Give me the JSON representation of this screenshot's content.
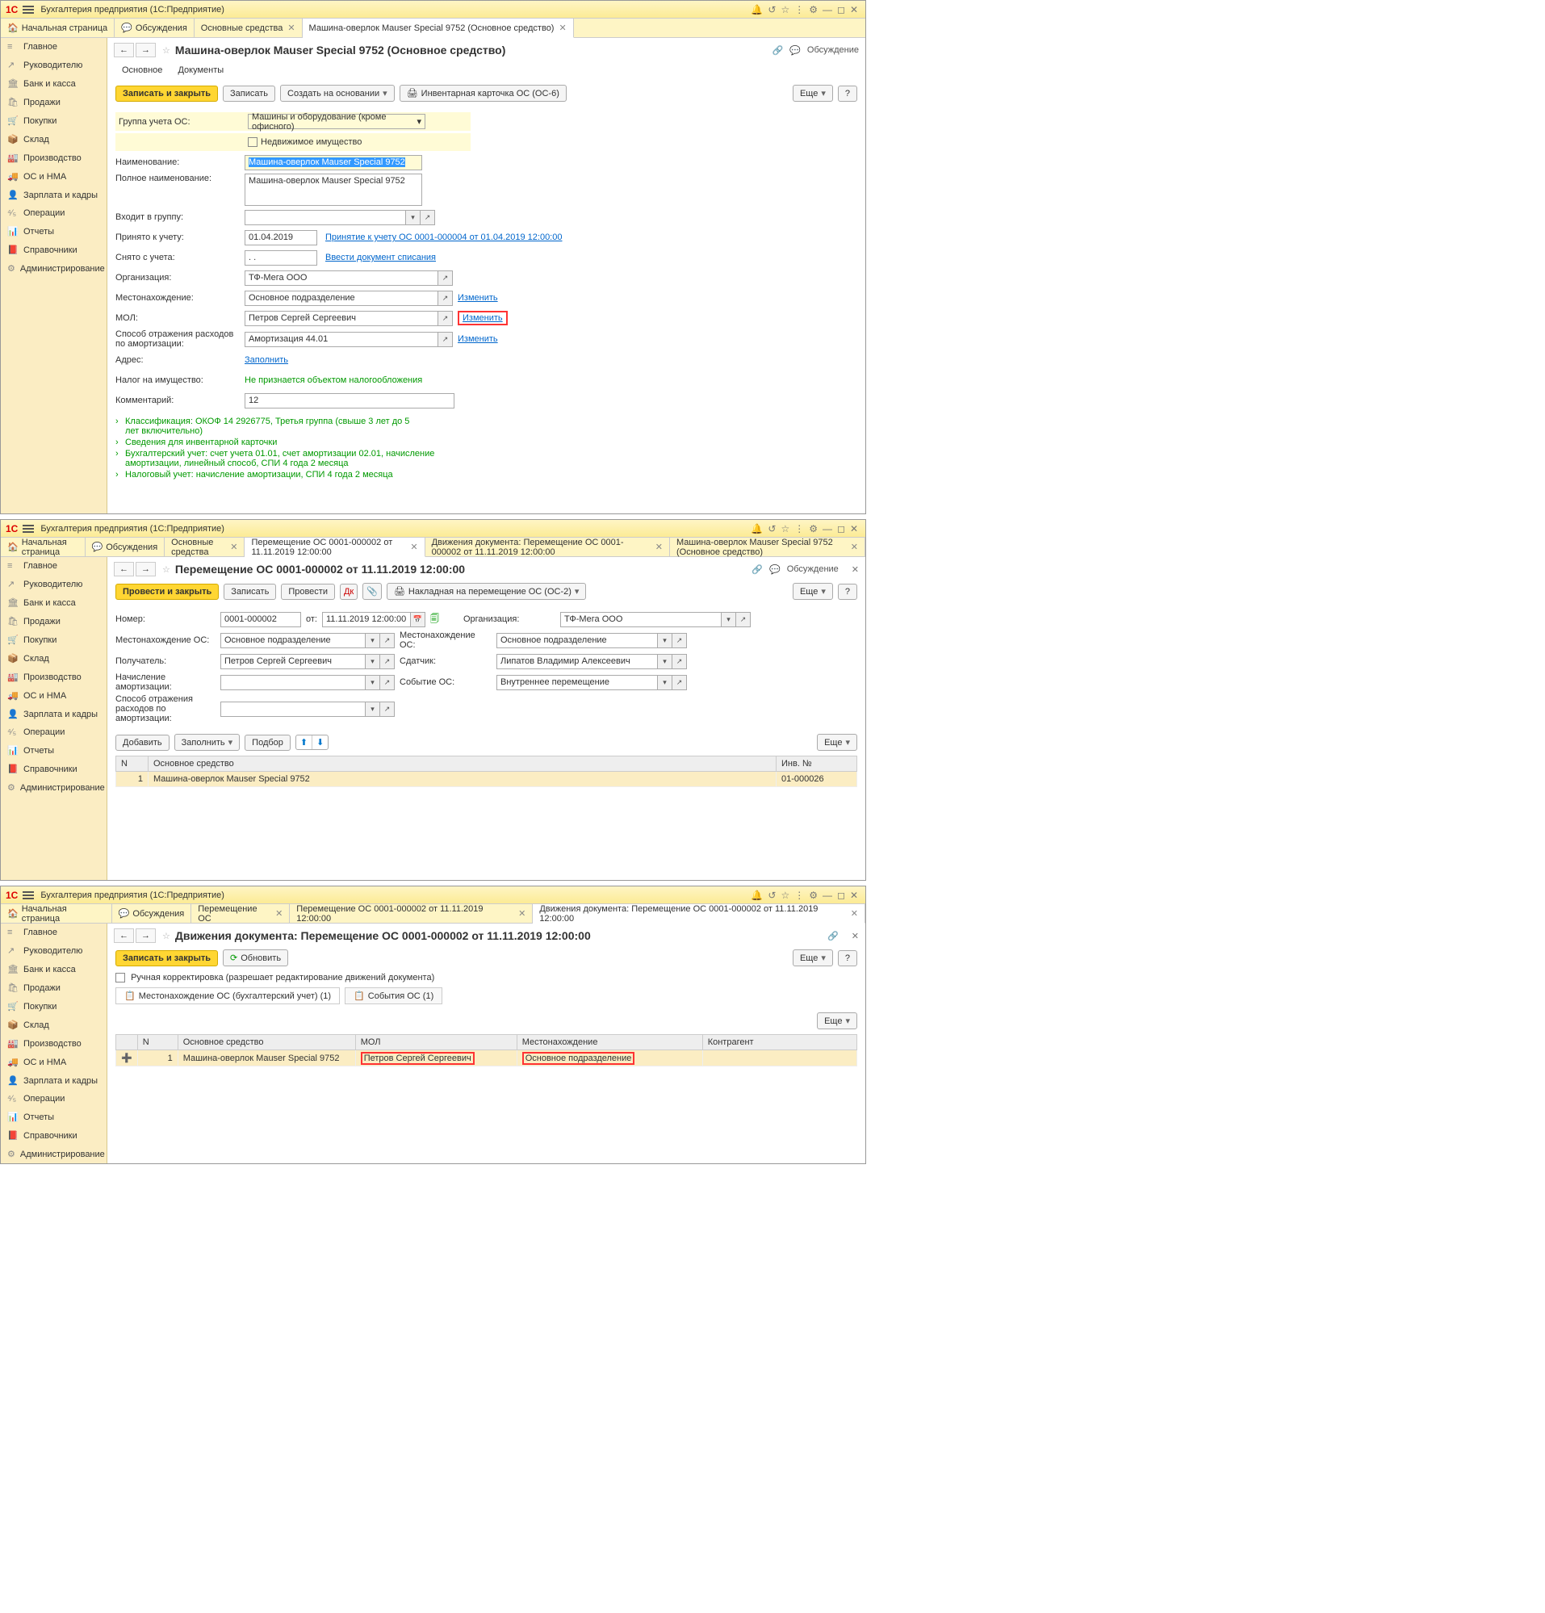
{
  "app_title": "Бухгалтерия предприятия  (1С:Предприятие)",
  "home_tab": "Начальная страница",
  "discuss_tab": "Обсуждения",
  "discuss_link": "Обсуждение",
  "sidebar": [
    {
      "icon": "≡",
      "label": "Главное"
    },
    {
      "icon": "↗",
      "label": "Руководителю"
    },
    {
      "icon": "🏛",
      "label": "Банк и касса"
    },
    {
      "icon": "🛍",
      "label": "Продажи"
    },
    {
      "icon": "🛒",
      "label": "Покупки"
    },
    {
      "icon": "📦",
      "label": "Склад"
    },
    {
      "icon": "🏭",
      "label": "Производство"
    },
    {
      "icon": "🚚",
      "label": "ОС и НМА"
    },
    {
      "icon": "👤",
      "label": "Зарплата и кадры"
    },
    {
      "icon": "⁴⁄₅",
      "label": "Операции"
    },
    {
      "icon": "📊",
      "label": "Отчеты"
    },
    {
      "icon": "📕",
      "label": "Справочники"
    },
    {
      "icon": "⚙",
      "label": "Администрирование"
    }
  ],
  "more_btn": "Еще",
  "help_btn": "?",
  "w1": {
    "tabs": [
      "Основные средства",
      "Машина-оверлок Mauser Special 9752 (Основное средство)"
    ],
    "title": "Машина-оверлок Mauser Special 9752 (Основное средство)",
    "subtabs": {
      "main": "Основное",
      "docs": "Документы"
    },
    "buttons": {
      "save_close": "Записать и закрыть",
      "save": "Записать",
      "create": "Создать на основании",
      "print": "Инвентарная карточка ОС (ОС-6)"
    },
    "labels": {
      "group": "Группа учета ОС:",
      "real_estate": "Недвижимое имущество",
      "name": "Наименование:",
      "full_name": "Полное наименование:",
      "in_group": "Входит в группу:",
      "accepted": "Принято к учету:",
      "removed": "Снято с учета:",
      "org": "Организация:",
      "location": "Местонахождение:",
      "mol": "МОЛ:",
      "method": "Способ отражения расходов по амортизации:",
      "address": "Адрес:",
      "tax": "Налог на имущество:",
      "comment": "Комментарий:"
    },
    "values": {
      "group": "Машины и оборудование (кроме офисного)",
      "name": "Машина-оверлок Mauser Special 9752",
      "full_name": "Машина-оверлок Mauser Special 9752",
      "accepted_date": "01.04.2019",
      "removed_date": ". .",
      "org": "ТФ-Мега ООО",
      "location": "Основное подразделение",
      "mol": "Петров Сергей Сергеевич",
      "method": "Амортизация 44.01",
      "tax": "Не признается объектом налогообложения",
      "comment": "12"
    },
    "links": {
      "accept": "Принятие к учету ОС 0001-000004 от 01.04.2019 12:00:00",
      "remove": "Ввести документ списания",
      "change": "Изменить",
      "fill": "Заполнить"
    },
    "expands": [
      "Классификация: ОКОФ 14 2926775, Третья группа (свыше 3 лет до 5 лет включительно)",
      "Сведения для инвентарной карточки",
      "Бухгалтерский учет: счет учета 01.01, счет амортизации 02.01, начисление амортизации, линейный способ, СПИ 4 года 2 месяца",
      "Налоговый учет: начисление амортизации, СПИ 4 года 2 месяца"
    ]
  },
  "w2": {
    "tabs": [
      "Основные средства",
      "Перемещение ОС 0001-000002 от 11.11.2019 12:00:00",
      "Движения документа: Перемещение ОС 0001-000002 от 11.11.2019 12:00:00",
      "Машина-оверлок Mauser Special 9752 (Основное средство)"
    ],
    "title": "Перемещение ОС 0001-000002 от 11.11.2019 12:00:00",
    "buttons": {
      "post_close": "Провести и закрыть",
      "save": "Записать",
      "post": "Провести",
      "print": "Накладная на перемещение ОС (ОС-2)",
      "add": "Добавить",
      "fill": "Заполнить",
      "pick": "Подбор"
    },
    "labels": {
      "number": "Номер:",
      "date": "от:",
      "org": "Организация:",
      "loc_os": "Местонахождение ОС:",
      "recv": "Получатель:",
      "amort": "Начисление амортизации:",
      "method": "Способ отражения расходов по амортизации:",
      "sender": "Сдатчик:",
      "event": "Событие ОС:"
    },
    "values": {
      "number": "0001-000002",
      "date": "11.11.2019 12:00:00",
      "org": "ТФ-Мега ООО",
      "loc_os1": "Основное подразделение",
      "loc_os2": "Основное подразделение",
      "recv": "Петров Сергей Сергеевич",
      "sender": "Липатов Владимир Алексеевич",
      "event": "Внутреннее перемещение"
    },
    "table": {
      "headers": {
        "n": "N",
        "os": "Основное средство",
        "inv": "Инв. №"
      },
      "rows": [
        {
          "n": "1",
          "os": "Машина-оверлок Mauser Special 9752",
          "inv": "01-000026"
        }
      ]
    }
  },
  "w3": {
    "tabs": [
      "Перемещение ОС",
      "Перемещение ОС 0001-000002 от 11.11.2019 12:00:00",
      "Движения документа: Перемещение ОС 0001-000002 от 11.11.2019 12:00:00"
    ],
    "title": "Движения документа: Перемещение ОС 0001-000002 от 11.11.2019 12:00:00",
    "buttons": {
      "save_close": "Записать и закрыть",
      "refresh": "Обновить"
    },
    "manual": "Ручная корректировка (разрешает редактирование движений документа)",
    "subtabs": {
      "loc": "Местонахождение ОС (бухгалтерский учет) (1)",
      "events": "События ОС (1)"
    },
    "table": {
      "headers": {
        "n": "N",
        "os": "Основное средство",
        "mol": "МОЛ",
        "loc": "Местонахождение",
        "contr": "Контрагент"
      },
      "rows": [
        {
          "n": "1",
          "os": "Машина-оверлок Mauser Special 9752",
          "mol": "Петров Сергей Сергеевич",
          "loc": "Основное подразделение"
        }
      ]
    }
  }
}
